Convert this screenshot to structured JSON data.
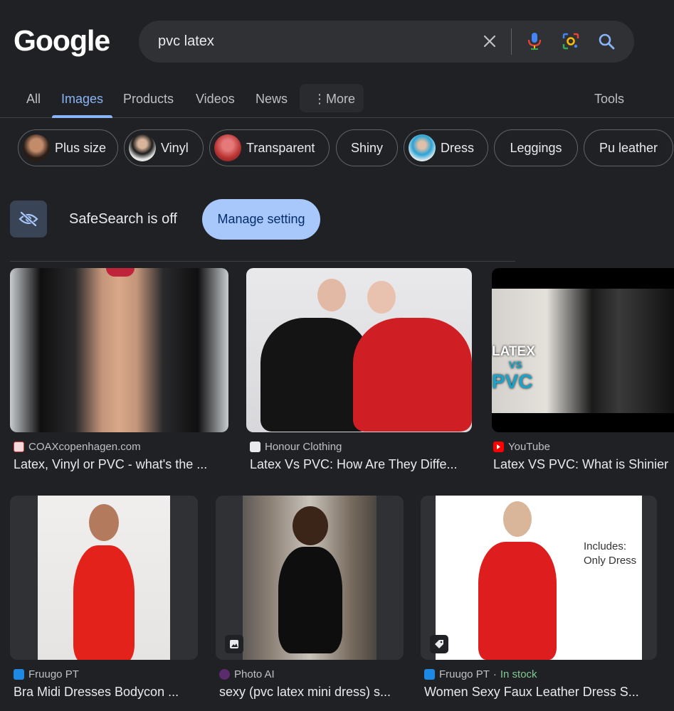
{
  "logo": "Google",
  "search": {
    "query": "pvc latex"
  },
  "tabs": [
    "All",
    "Images",
    "Products",
    "Videos",
    "News",
    "More",
    "Tools"
  ],
  "chips": [
    {
      "label": "Plus size",
      "thumb": "#7a4b3a"
    },
    {
      "label": "Vinyl",
      "thumb": "#2b2b2b"
    },
    {
      "label": "Transparent",
      "thumb": "#c94d4d"
    },
    {
      "label": "Shiny",
      "thumb": ""
    },
    {
      "label": "Dress",
      "thumb": "#2aa3d6"
    },
    {
      "label": "Leggings",
      "thumb": ""
    },
    {
      "label": "Pu leather",
      "thumb": ""
    }
  ],
  "safesearch": {
    "text": "SafeSearch is off",
    "button": "Manage setting"
  },
  "results": [
    {
      "source": "COAXcopenhagen.com",
      "title": "Latex, Vinyl or PVC - what's the ...",
      "favicon": "#d6d6d6"
    },
    {
      "source": "Honour Clothing",
      "title": "Latex Vs PVC: How Are They Diffe...",
      "favicon": "#e8eaed"
    },
    {
      "source": "YouTube",
      "title": "Latex VS PVC: What is Shinier",
      "favicon": "#ff0000",
      "overlay_text": [
        "LATEX",
        "VS",
        "PVC"
      ]
    },
    {
      "source": "Fruugo PT",
      "title": "Bra Midi Dresses Bodycon ...",
      "favicon": "#1e88e5"
    },
    {
      "source": "Photo AI",
      "title": "sexy (pvc latex mini dress) s...",
      "favicon": "#5c2a6e"
    },
    {
      "source": "Fruugo PT",
      "stock": "In stock",
      "title": "Women Sexy Faux Leather Dress S...",
      "favicon": "#1e88e5",
      "overlay_text": [
        "Includes:",
        "Only Dress"
      ]
    }
  ],
  "colors": {
    "accent": "#8ab4f8",
    "background": "#202124",
    "button": "#a8c7fa"
  }
}
